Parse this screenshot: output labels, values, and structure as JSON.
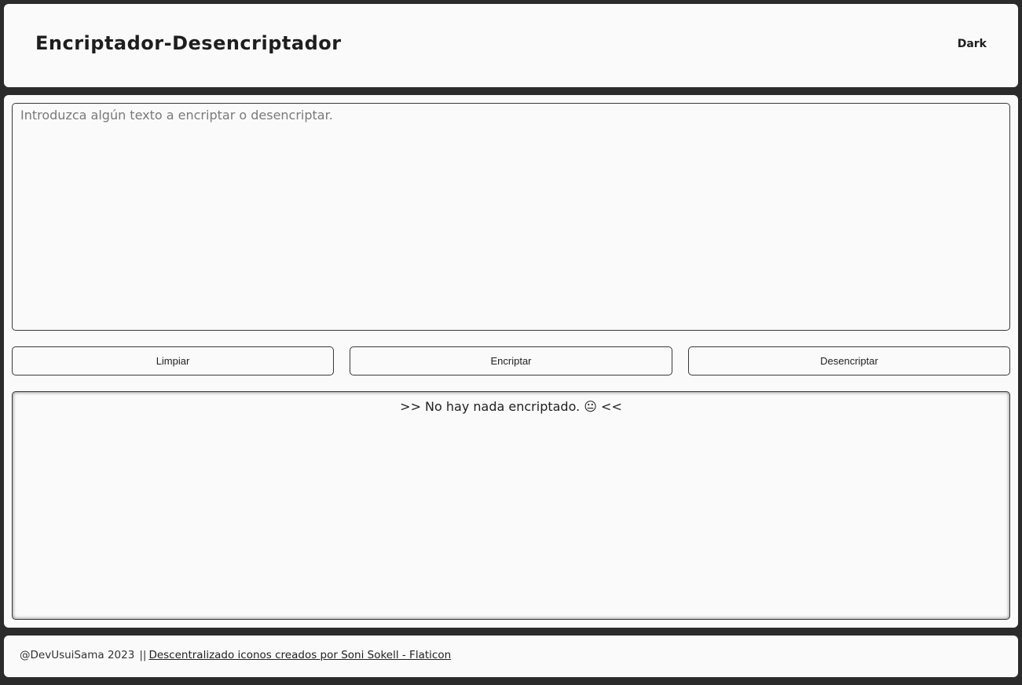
{
  "header": {
    "title": "Encriptador-Desencriptador",
    "theme_toggle_label": "Dark"
  },
  "input": {
    "placeholder": "Introduzca algún texto a encriptar o desencriptar.",
    "value": ""
  },
  "buttons": {
    "clear": "Limpiar",
    "encrypt": "Encriptar",
    "decrypt": "Desencriptar"
  },
  "output": {
    "message": ">> No hay nada encriptado. 😐 <<"
  },
  "footer": {
    "credit": "@DevUsuiSama 2023",
    "separator": "||",
    "link_text": "Descentralizado iconos creados por Soni Sokell - Flaticon"
  }
}
